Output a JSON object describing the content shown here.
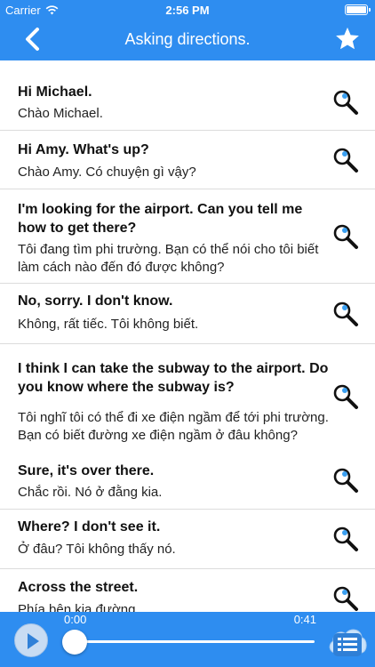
{
  "status_bar": {
    "carrier": "Carrier",
    "time": "2:56 PM"
  },
  "nav": {
    "title": "Asking directions."
  },
  "phrases": [
    {
      "english": "Hi Michael.",
      "vietnamese": "Chào Michael."
    },
    {
      "english": "Hi Amy. What's up?",
      "vietnamese": "Chào Amy. Có chuyện gì vậy?"
    },
    {
      "english": "I'm looking for the airport. Can you tell me how to get there?",
      "vietnamese": "Tôi đang tìm phi trường. Bạn có thể nói cho tôi biết làm cách nào đến đó được không?"
    },
    {
      "english": "No, sorry. I don't know.",
      "vietnamese": "Không, rất tiếc. Tôi không biết."
    },
    {
      "english": "I think I can take the subway to the airport. Do you know where the subway is?",
      "vietnamese": "Tôi nghĩ tôi có thể đi xe điện ngầm để tới phi trường. Bạn có biết đường xe điện ngầm ở đâu không?"
    },
    {
      "english": "Sure, it's over there.",
      "vietnamese": "Chắc rồi. Nó ở đằng kia."
    },
    {
      "english": "Where? I don't see it.",
      "vietnamese": "Ở đâu? Tôi không thấy nó."
    },
    {
      "english": "Across the street.",
      "vietnamese": "Phía bên kia đường."
    }
  ],
  "player": {
    "current_time": "0:00",
    "total_time": "0:41",
    "progress": 0
  },
  "colors": {
    "brand": "#2e8df0",
    "icon_accent": "#3a9ff0"
  },
  "icons": {
    "back": "chevron-left-icon",
    "favorite": "star-icon",
    "lookup": "magnifier-icon",
    "play": "play-icon",
    "playlist": "list-icon"
  }
}
